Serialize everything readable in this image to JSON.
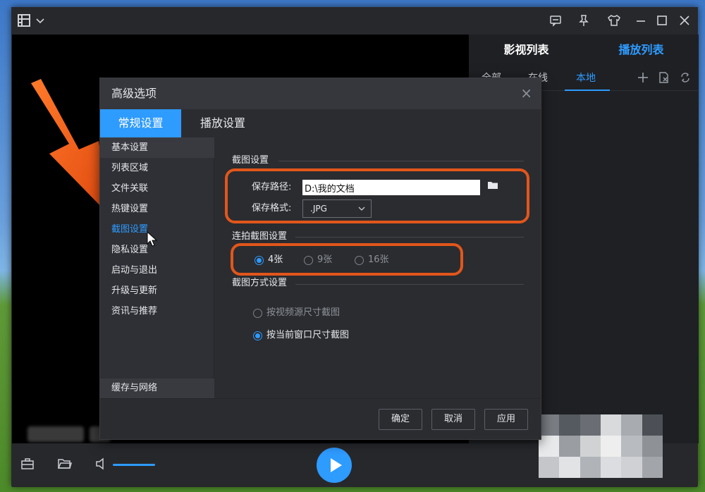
{
  "player": {
    "playlist_tabs": [
      "影视列表",
      "播放列表"
    ],
    "sub_tabs": [
      "全部",
      "在线",
      "本地"
    ],
    "colors": {
      "accent": "#2e9bff",
      "highlight": "#e2561b"
    },
    "titlebar_icons": [
      "grid-menu-icon",
      "chevron-down-icon",
      "chat-icon",
      "pin-icon",
      "skin-icon",
      "minimize-icon",
      "maximize-icon",
      "close-icon"
    ],
    "tool_icons": [
      "add-icon",
      "delete-file-icon",
      "refresh-icon"
    ],
    "control_icons": [
      "toolbox-icon",
      "open-folder-icon",
      "volume-icon",
      "play-icon"
    ]
  },
  "dialog": {
    "title": "高级选项",
    "close_glyph": "×",
    "tabs": [
      "常规设置",
      "播放设置"
    ],
    "sidebar": [
      "基本设置",
      "列表区域",
      "文件关联",
      "热键设置",
      "截图设置",
      "隐私设置",
      "启动与退出",
      "升级与更新",
      "资讯与推荐"
    ],
    "sidebar_bottom": "缓存与网络",
    "screenshot": {
      "section_title": "截图设置",
      "save_path_label": "保存路径:",
      "save_path_value": "D:\\我的文档",
      "format_label": "保存格式:",
      "format_value": ".JPG"
    },
    "burst": {
      "section_title": "连拍截图设置",
      "options": [
        "4张",
        "9张",
        "16张"
      ],
      "selected": "4张"
    },
    "mode": {
      "section_title": "截图方式设置",
      "options": [
        "按视频源尺寸截图",
        "按当前窗口尺寸截图"
      ],
      "selected": "按当前窗口尺寸截图"
    },
    "buttons": {
      "ok": "确定",
      "cancel": "取消",
      "apply": "应用"
    }
  }
}
